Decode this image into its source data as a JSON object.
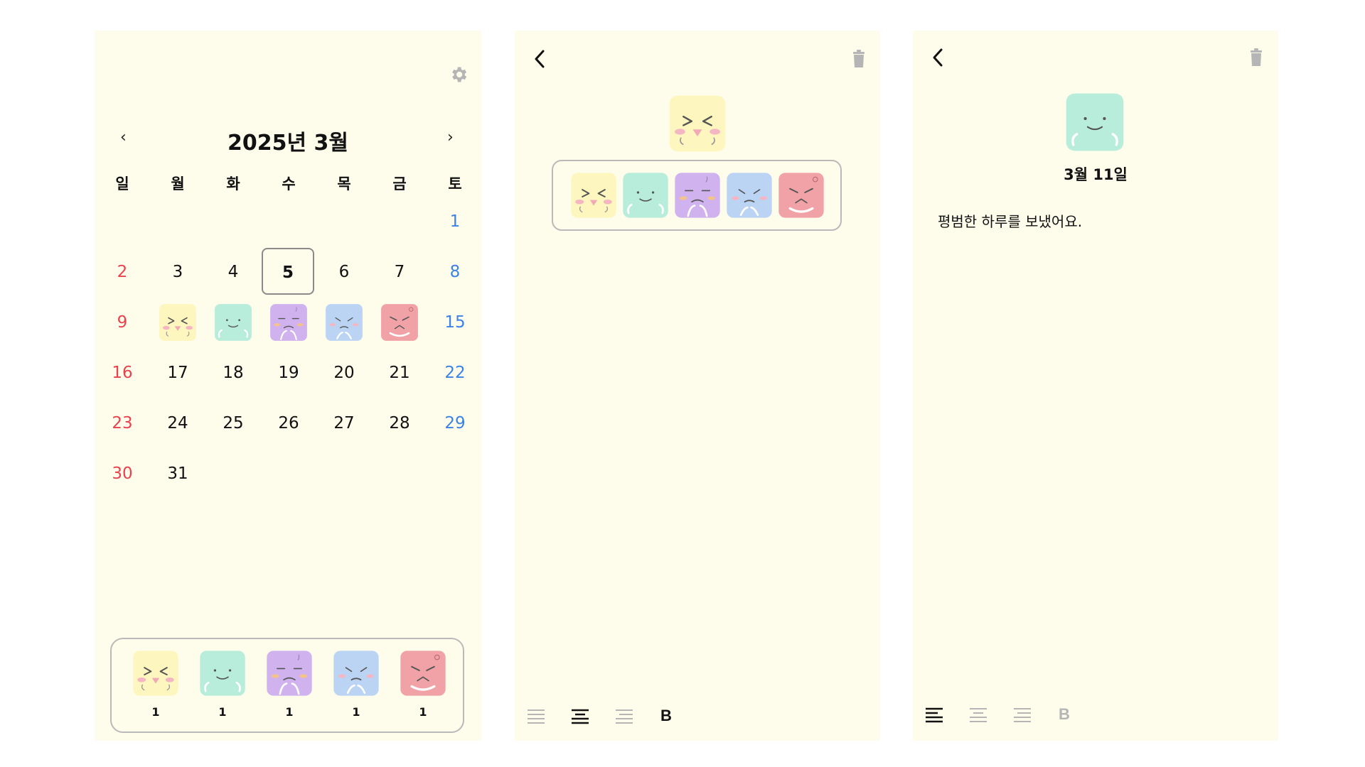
{
  "colors": {
    "panel_bg": "#fefdec",
    "sunday": "#e8424e",
    "saturday": "#3c82e6",
    "emo_yellow": "#fef6bf",
    "emo_mint": "#b8ecdb",
    "emo_purple": "#d0b2ee",
    "emo_blue": "#bcd4f4",
    "emo_red": "#f0a2a6",
    "icon_gray": "#b5b5b5"
  },
  "calendar": {
    "title": "2025년 3월",
    "prev_icon": "‹",
    "next_icon": "›",
    "weekdays": [
      "일",
      "월",
      "화",
      "수",
      "목",
      "금",
      "토"
    ],
    "days": {
      "d1": "1",
      "d2": "2",
      "d3": "3",
      "d4": "4",
      "d5": "5",
      "d6": "6",
      "d7": "7",
      "d8": "8",
      "d9": "9",
      "d15": "15",
      "d16": "16",
      "d17": "17",
      "d18": "18",
      "d19": "19",
      "d20": "20",
      "d21": "21",
      "d22": "22",
      "d23": "23",
      "d24": "24",
      "d25": "25",
      "d26": "26",
      "d27": "27",
      "d28": "28",
      "d29": "29",
      "d30": "30",
      "d31": "31"
    },
    "today": "5",
    "summary_counts": [
      "1",
      "1",
      "1",
      "1",
      "1"
    ]
  },
  "editor": {
    "toolbar": {
      "bold_label": "B"
    }
  },
  "detail": {
    "date": "3월 11일",
    "text": "평범한 하루를 보냈어요.",
    "toolbar": {
      "bold_label": "B"
    }
  }
}
